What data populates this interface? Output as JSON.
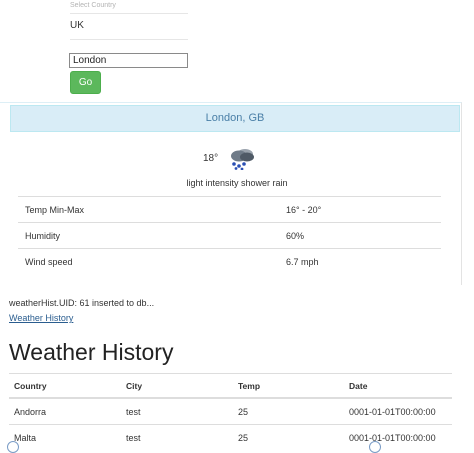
{
  "form": {
    "country_label": "Select Country",
    "country_value": "UK",
    "city_value": "London",
    "go_label": "Go"
  },
  "weather": {
    "location": "London, GB",
    "temperature": "18°",
    "icon": "shower-rain-icon",
    "description": "light intensity shower rain",
    "stats": [
      {
        "label": "Temp Min-Max",
        "value": "16° - 20°"
      },
      {
        "label": "Humidity",
        "value": "60%"
      },
      {
        "label": "Wind speed",
        "value": "6.7 mph"
      }
    ]
  },
  "status": {
    "insert_message": "weatherHist.UID: 61 inserted to db...",
    "history_link": "Weather History"
  },
  "history": {
    "title": "Weather History",
    "columns": [
      "Country",
      "City",
      "Temp",
      "Date"
    ],
    "rows": [
      [
        "Andorra",
        "test",
        "25",
        "0001-01-01T00:00:00"
      ],
      [
        "Malta",
        "test",
        "25",
        "0001-01-01T00:00:00"
      ]
    ]
  },
  "colors": {
    "go_button": "#5cb85c",
    "panel_heading_bg": "#d9edf7",
    "panel_heading_text": "#4a7fa7",
    "link": "#2a5d8f"
  }
}
